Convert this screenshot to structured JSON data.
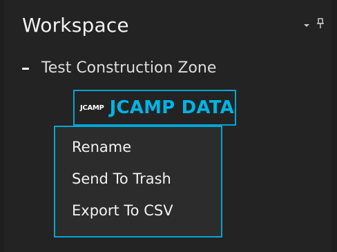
{
  "panel": {
    "title": "Workspace"
  },
  "tree": {
    "group_label": "Test Construction Zone",
    "selected_node": {
      "logo_text": "JCAMP",
      "label": "JCAMP DATA"
    }
  },
  "context_menu": {
    "items": [
      {
        "label": "Rename"
      },
      {
        "label": "Send To Trash"
      },
      {
        "label": "Export To CSV"
      }
    ]
  },
  "colors": {
    "background": "#232323",
    "accent": "#00a7d6",
    "node_text": "#00b4e6"
  },
  "icons": {
    "dropdown": "chevron-down-icon",
    "pin": "pin-icon",
    "collapse": "collapse-icon"
  }
}
